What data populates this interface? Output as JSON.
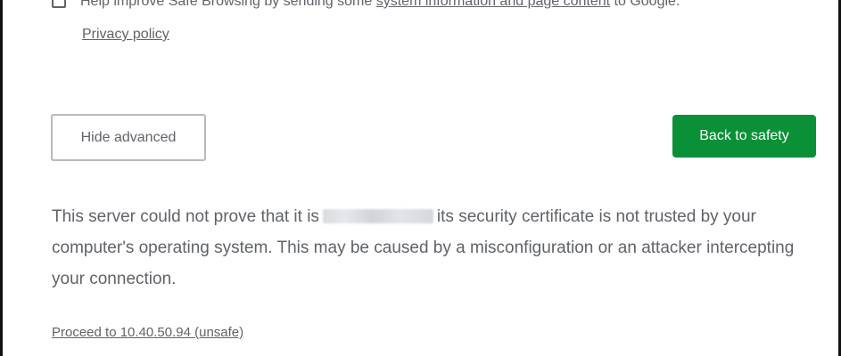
{
  "optin": {
    "text_before": "Help improve Safe Browsing by sending some ",
    "link_text": "system information and page content",
    "text_after": " to Google.",
    "privacy_link": "Privacy policy"
  },
  "buttons": {
    "hide_advanced": "Hide advanced",
    "back_to_safety": "Back to safety"
  },
  "explanation": {
    "before_host": "This server could not prove that it is",
    "after_host": "its security certificate is not trusted by your computer's operating system. This may be caused by a misconfiguration or an attacker intercepting your connection."
  },
  "proceed_link": "Proceed to 10.40.50.94 (unsafe)",
  "colors": {
    "primary_button": "#0a9137",
    "text": "#5f6368",
    "secondary_border": "#b7b9bd"
  }
}
